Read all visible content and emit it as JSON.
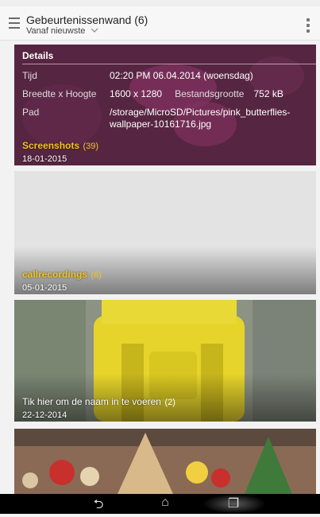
{
  "app_bar": {
    "title": "Gebeurtenissenwand (6)",
    "sort_label": "Vanaf nieuwste",
    "icons": [
      "menu-icon",
      "chevron-down-icon",
      "overflow-menu-icon"
    ]
  },
  "details": {
    "heading": "Details",
    "time_label": "Tijd",
    "time_value": "02:20 PM 06.04.2014 (woensdag)",
    "dims_label": "Breedte x Hoogte",
    "dims_value": "1600 x 1280",
    "size_label": "Bestandsgrootte",
    "size_value": "752 kB",
    "path_label": "Pad",
    "path_line1": "/storage/MicroSD/Pictures/pink_butterflies-",
    "path_line2": "wallpaper-10161716.jpg"
  },
  "cards": [
    {
      "name": "Screenshots",
      "count": "(39)",
      "date": "18-01-2015"
    },
    {
      "name": "callrecordings",
      "count": "(6)",
      "date": "05-01-2015"
    },
    {
      "name": "Tik hier om de naam in te voeren",
      "count": "(2)",
      "date": "22-12-2014"
    },
    {
      "name": "",
      "count": "",
      "date": ""
    }
  ],
  "nav": {
    "back": "⮌",
    "home": "⌂",
    "recents": "❐"
  },
  "colors": {
    "accent": "#f2c41c"
  }
}
